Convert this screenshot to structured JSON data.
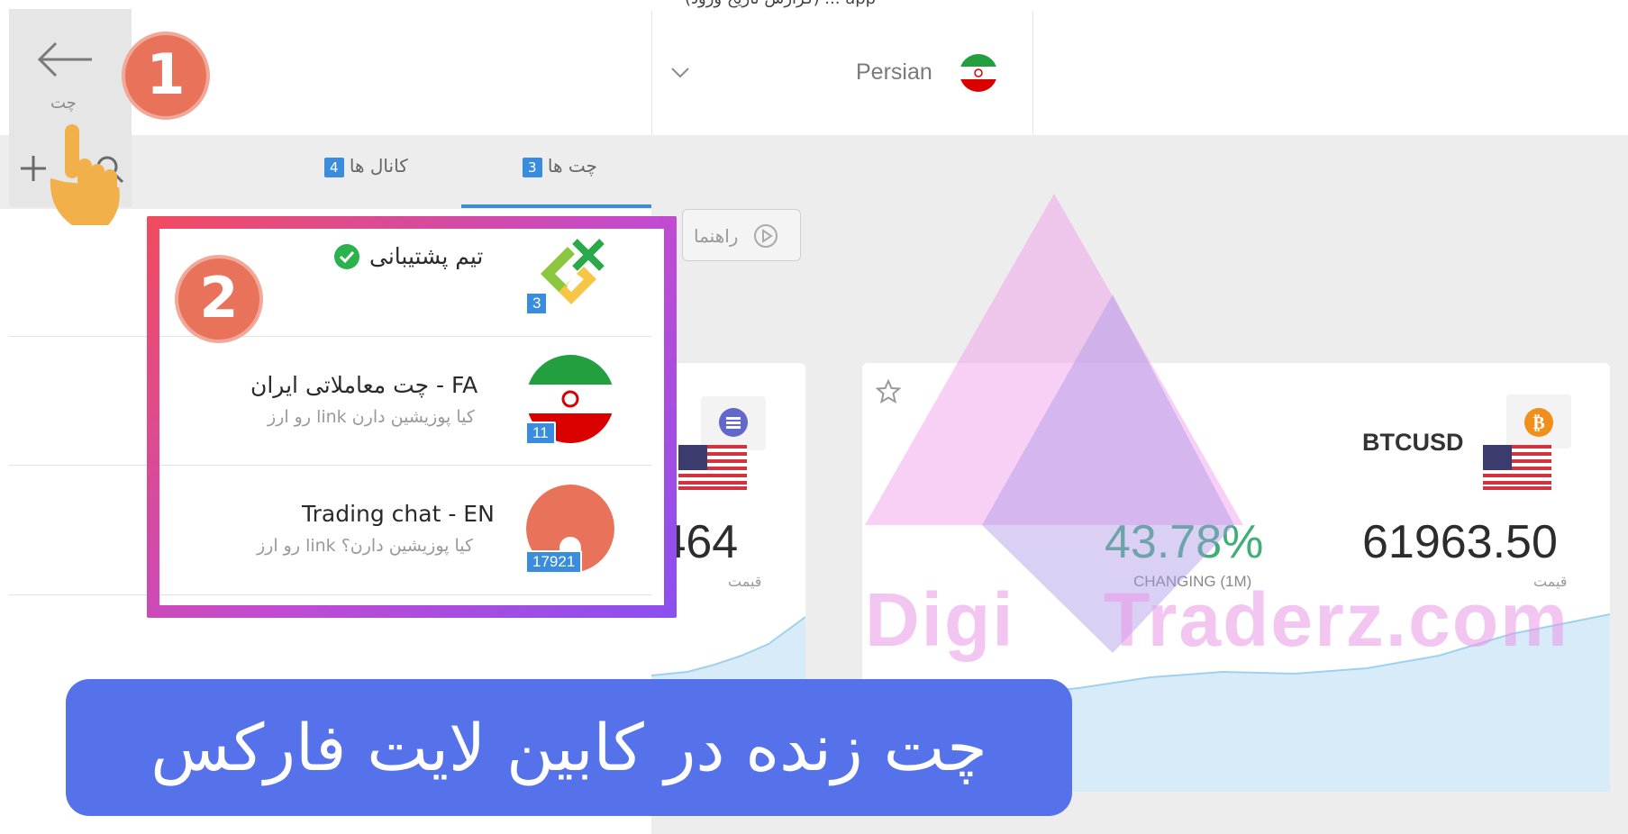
{
  "header": {
    "top_cut_text": "(گزارش تاریخ ورود) ... app",
    "language": {
      "label": "Persian",
      "flag": "iran-flag-icon"
    }
  },
  "nav": {
    "back_label": "چت",
    "step1_number": "1",
    "step2_number": "2"
  },
  "tabs": [
    {
      "label": "چت ها",
      "count": "3",
      "active": true
    },
    {
      "label": "کانال ها",
      "count": "4",
      "active": false
    }
  ],
  "toolbar": {
    "guide_label": "راهنما"
  },
  "chats": [
    {
      "title": "تیم پشتیبانی",
      "subtitle": "",
      "count": "3",
      "verified": true,
      "avatar": "litefinance-logo-icon"
    },
    {
      "title": "چت معاملاتی ایران - FA",
      "subtitle": "رو ارز link کیا پوزیشین دارن",
      "count": "11",
      "verified": false,
      "avatar": "iran-flag-avatar"
    },
    {
      "title": "Trading chat - EN",
      "subtitle": "رو ارز link کیا پوزیشین دارن؟",
      "count": "17921",
      "verified": false,
      "avatar": "orange-chat-avatar"
    }
  ],
  "cards": [
    {
      "symbol": "",
      "price": ".464",
      "price_label": "قیمت",
      "coin_icon": "ethereum-coin-icon",
      "flag": "us-flag-icon"
    },
    {
      "symbol": "BTCUSD",
      "price": "61963.50",
      "price_label": "قیمت",
      "change": "43.78%",
      "change_label": "CHANGING (1M)",
      "coin_icon": "bitcoin-coin-icon",
      "flag": "us-flag-icon",
      "favorite_icon": "star-icon"
    }
  ],
  "watermark": {
    "left": "Digi",
    "right": "Traderz.com"
  },
  "banner": {
    "text": "چت زنده در کابین لایت فارکس"
  },
  "colors": {
    "accent": "#3a8dde",
    "banner": "#5572ea",
    "positive": "#3fae78",
    "step_circle": "#e8735a"
  }
}
